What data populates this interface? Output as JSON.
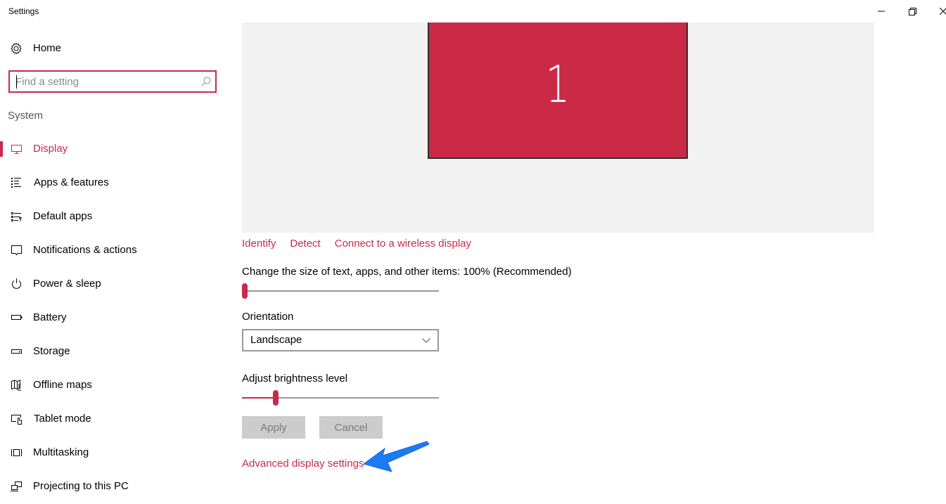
{
  "window": {
    "title": "Settings",
    "controls": {
      "minimize": "minimize-icon",
      "restore": "restore-icon",
      "close": "close-icon"
    }
  },
  "sidebar": {
    "home": {
      "label": "Home",
      "icon": "gear-icon"
    },
    "search": {
      "placeholder": "Find a setting",
      "value": "",
      "icon": "search-icon"
    },
    "section": "System",
    "items": [
      {
        "label": "Display",
        "icon": "display-icon",
        "active": true
      },
      {
        "label": "Apps & features",
        "icon": "apps-list-icon",
        "active": false
      },
      {
        "label": "Default apps",
        "icon": "default-apps-icon",
        "active": false
      },
      {
        "label": "Notifications & actions",
        "icon": "notification-icon",
        "active": false
      },
      {
        "label": "Power & sleep",
        "icon": "power-icon",
        "active": false
      },
      {
        "label": "Battery",
        "icon": "battery-icon",
        "active": false
      },
      {
        "label": "Storage",
        "icon": "storage-icon",
        "active": false
      },
      {
        "label": "Offline maps",
        "icon": "map-icon",
        "active": false
      },
      {
        "label": "Tablet mode",
        "icon": "tablet-mode-icon",
        "active": false
      },
      {
        "label": "Multitasking",
        "icon": "multitasking-icon",
        "active": false
      },
      {
        "label": "Projecting to this PC",
        "icon": "projecting-icon",
        "active": false
      }
    ]
  },
  "main": {
    "monitor": {
      "number": "1",
      "color": "#cb2a47"
    },
    "links": [
      "Identify",
      "Detect",
      "Connect to a wireless display"
    ],
    "scale": {
      "label": "Change the size of text, apps, and other items: 100% (Recommended)",
      "value_fraction": 0.0
    },
    "orientation": {
      "label": "Orientation",
      "selected": "Landscape"
    },
    "brightness": {
      "label": "Adjust brightness level",
      "value_percent": 16
    },
    "buttons": {
      "apply": "Apply",
      "cancel": "Cancel"
    },
    "advanced_link": "Advanced display settings",
    "annotation": {
      "type": "arrow",
      "color": "#1a7cf2"
    }
  },
  "colors": {
    "accent": "#c9294b",
    "preview_bg": "#f2f2f2",
    "button_disabled": "#cccccc"
  }
}
